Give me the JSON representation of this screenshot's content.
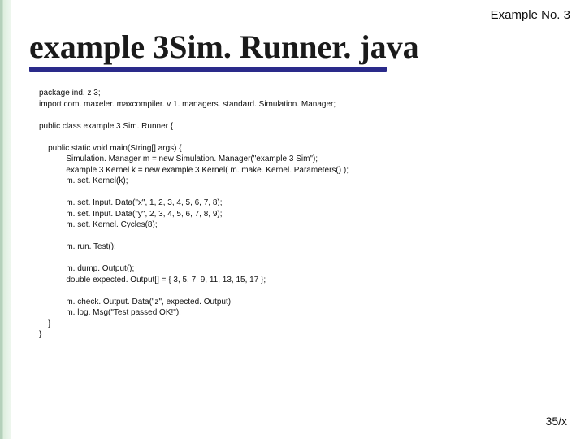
{
  "header": {
    "label": "Example No. 3"
  },
  "title": "example 3Sim. Runner. java",
  "code": {
    "l01": "package ind. z 3;",
    "l02": "import com. maxeler. maxcompiler. v 1. managers. standard. Simulation. Manager;",
    "l03": "public class example 3 Sim. Runner {",
    "l04": "    public static void main(String[] args) {",
    "l05": "            Simulation. Manager m = new Simulation. Manager(\"example 3 Sim\");",
    "l06": "            example 3 Kernel k = new example 3 Kernel( m. make. Kernel. Parameters() );",
    "l07": "            m. set. Kernel(k);",
    "l08": "            m. set. Input. Data(\"x\", 1, 2, 3, 4, 5, 6, 7, 8);",
    "l09": "            m. set. Input. Data(\"y\", 2, 3, 4, 5, 6, 7, 8, 9);",
    "l10": "            m. set. Kernel. Cycles(8);",
    "l11": "            m. run. Test();",
    "l12": "            m. dump. Output();",
    "l13": "            double expected. Output[] = { 3, 5, 7, 9, 11, 13, 15, 17 };",
    "l14": "            m. check. Output. Data(\"z\", expected. Output);",
    "l15": "            m. log. Msg(\"Test passed OK!\");",
    "l16": "    }",
    "l17": "}"
  },
  "footer": {
    "page": "35/x"
  }
}
